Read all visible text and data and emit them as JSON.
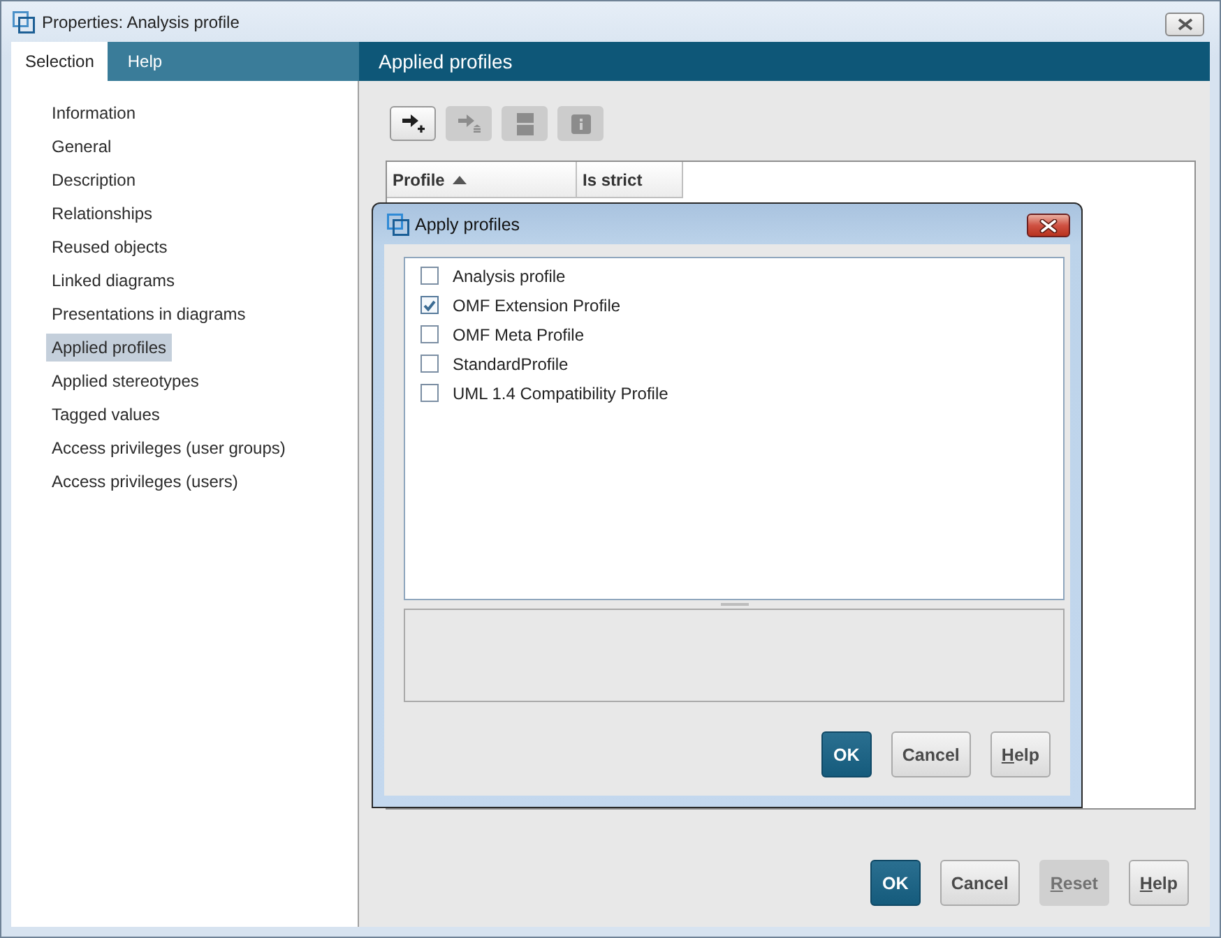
{
  "window": {
    "title": "Properties: Analysis profile"
  },
  "tabs": [
    {
      "label": "Selection",
      "selected": true
    },
    {
      "label": "Help",
      "selected": false
    }
  ],
  "sidebar": {
    "items": [
      {
        "label": "Information",
        "selected": false
      },
      {
        "label": "General",
        "selected": false
      },
      {
        "label": "Description",
        "selected": false
      },
      {
        "label": "Relationships",
        "selected": false
      },
      {
        "label": "Reused objects",
        "selected": false
      },
      {
        "label": "Linked diagrams",
        "selected": false
      },
      {
        "label": "Presentations in diagrams",
        "selected": false
      },
      {
        "label": "Applied profiles",
        "selected": true
      },
      {
        "label": "Applied stereotypes",
        "selected": false
      },
      {
        "label": "Tagged values",
        "selected": false
      },
      {
        "label": "Access privileges (user groups)",
        "selected": false
      },
      {
        "label": "Access privileges (users)",
        "selected": false
      }
    ]
  },
  "panel": {
    "title": "Applied profiles",
    "toolbar": [
      {
        "kind": "add",
        "disabled": false
      },
      {
        "kind": "remove",
        "disabled": true
      },
      {
        "kind": "drawer",
        "disabled": true
      },
      {
        "kind": "info",
        "disabled": true
      }
    ],
    "table": {
      "columns": [
        {
          "label": "Profile",
          "sorted": true
        },
        {
          "label": "Is strict",
          "sorted": false
        }
      ]
    }
  },
  "dialog": {
    "title": "Apply profiles",
    "items": [
      {
        "label": "Analysis profile",
        "checked": false
      },
      {
        "label": "OMF Extension Profile",
        "checked": true
      },
      {
        "label": "OMF Meta Profile",
        "checked": false
      },
      {
        "label": "StandardProfile",
        "checked": false
      },
      {
        "label": "UML 1.4 Compatibility Profile",
        "checked": false
      }
    ],
    "buttons": [
      {
        "label": "OK",
        "kind": "primary",
        "disabled": false,
        "mnemonic": false
      },
      {
        "label": "Cancel",
        "kind": "secondary",
        "disabled": false,
        "mnemonic": false
      },
      {
        "label": "Help",
        "kind": "secondary",
        "disabled": false,
        "mnemonic": true
      }
    ]
  },
  "buttons": [
    {
      "label": "OK",
      "kind": "primary",
      "disabled": false,
      "mnemonic": false
    },
    {
      "label": "Cancel",
      "kind": "secondary",
      "disabled": false,
      "mnemonic": false
    },
    {
      "label": "Reset",
      "kind": "secondary",
      "disabled": true,
      "mnemonic": true
    },
    {
      "label": "Help",
      "kind": "secondary",
      "disabled": false,
      "mnemonic": true
    }
  ]
}
